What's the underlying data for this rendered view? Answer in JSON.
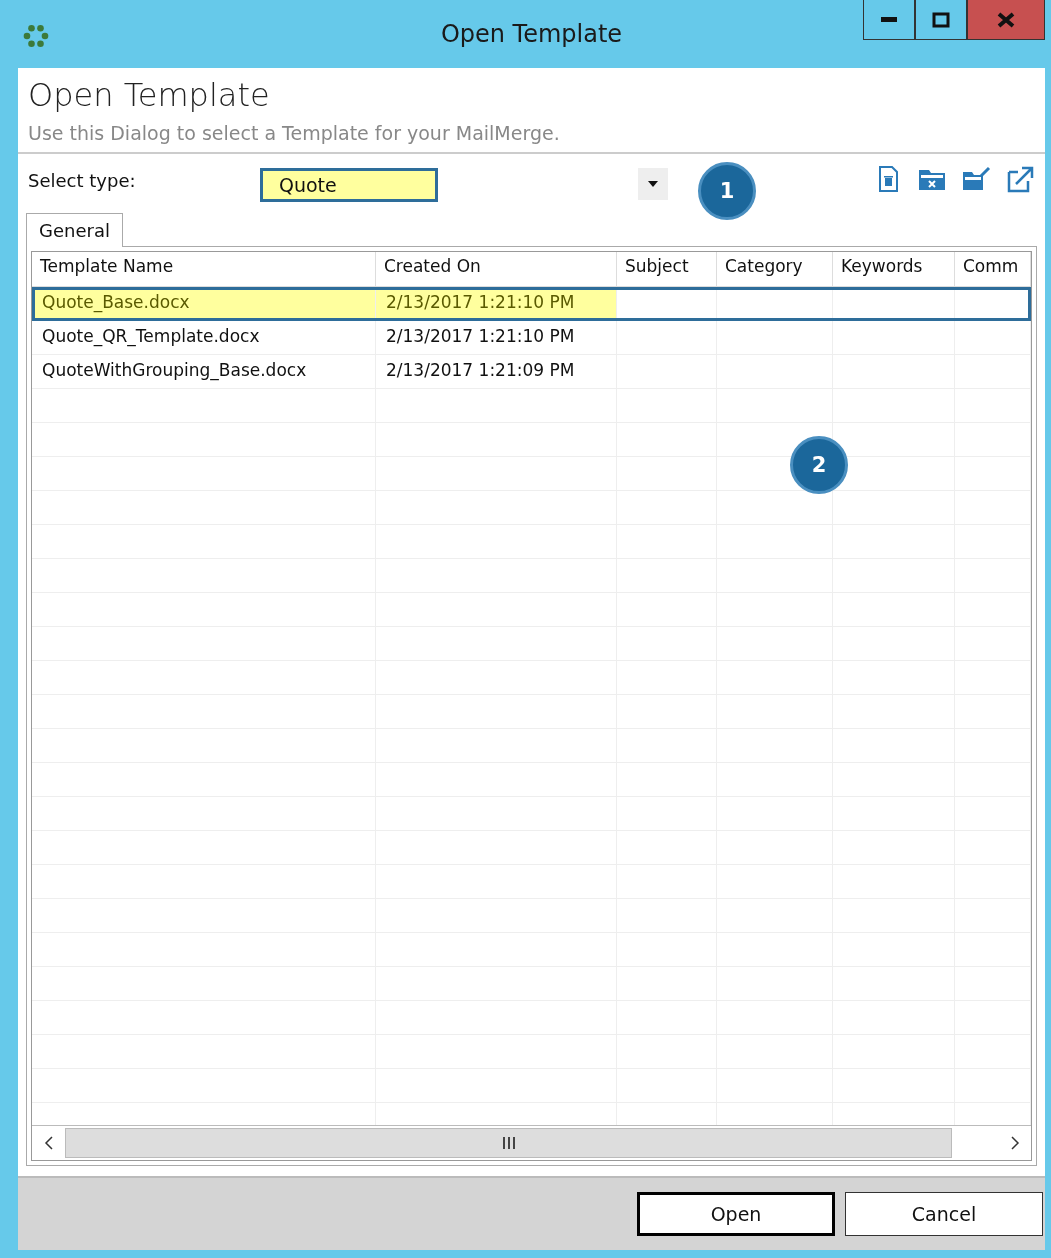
{
  "window": {
    "title": "Open Template"
  },
  "header": {
    "title": "Open Template",
    "subtitle": "Use this Dialog to select a Template for your MailMerge."
  },
  "select_type": {
    "label": "Select type:",
    "value": "Quote"
  },
  "tabs": [
    {
      "label": "General",
      "selected": true
    }
  ],
  "table": {
    "columns": [
      "Template Name",
      "Created On",
      "Subject",
      "Category",
      "Keywords",
      "Comm"
    ],
    "rows": [
      {
        "cells": [
          "Quote_Base.docx",
          "2/13/2017 1:21:10 PM"
        ],
        "selected": true
      },
      {
        "cells": [
          "Quote_QR_Template.docx",
          "2/13/2017 1:21:10 PM"
        ],
        "selected": false
      },
      {
        "cells": [
          "QuoteWithGrouping_Base.docx",
          "2/13/2017 1:21:09 PM"
        ],
        "selected": false
      }
    ]
  },
  "callouts": [
    "1",
    "2"
  ],
  "buttons": [
    "Open",
    "Cancel"
  ]
}
